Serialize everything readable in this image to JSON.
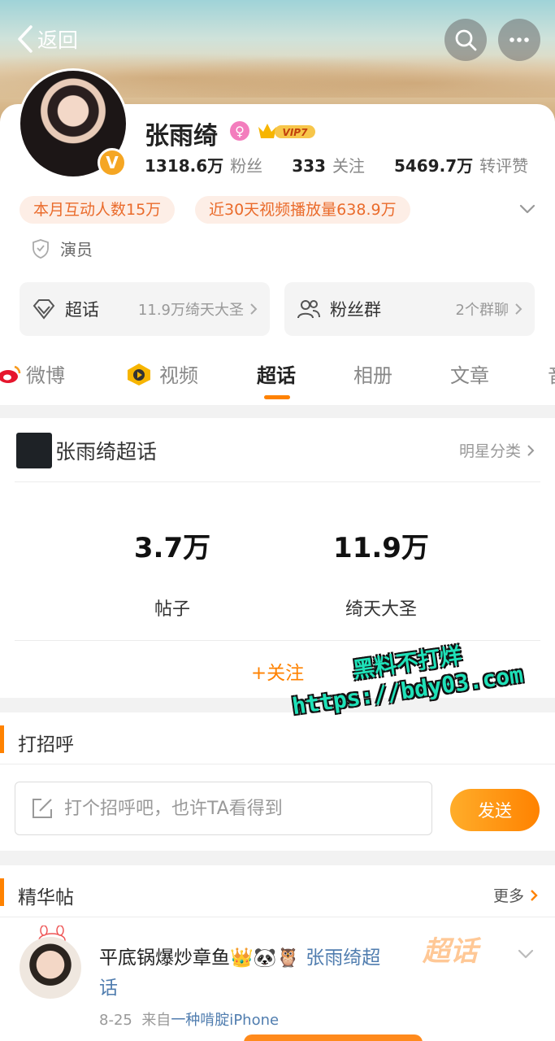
{
  "header": {
    "back_label": "返回"
  },
  "profile": {
    "name": "张雨绮",
    "vip_label": "VIP7",
    "verified_mark": "V",
    "stats": [
      {
        "value": "1318.6万",
        "label": "粉丝"
      },
      {
        "value": "333",
        "label": "关注"
      },
      {
        "value": "5469.7万",
        "label": "转评赞"
      }
    ],
    "chips": [
      "本月互动人数15万",
      "近30天视频播放量638.9万"
    ],
    "role": "演员"
  },
  "quick_links": {
    "chaohua": {
      "title": "超话",
      "sub": "11.9万绮天大圣"
    },
    "fans_group": {
      "title": "粉丝群",
      "sub": "2个群聊"
    }
  },
  "tabs": [
    "微博",
    "视频",
    "超话",
    "相册",
    "文章",
    "音"
  ],
  "active_tab": "超话",
  "supertopic": {
    "title": "张雨绮超话",
    "category": "明星分类",
    "posts_count": "3.7万",
    "posts_label": "帖子",
    "fans_count": "11.9万",
    "fans_label": "绮天大圣",
    "follow_label": "+关注"
  },
  "greeting": {
    "title": "打招呼",
    "placeholder": "打个招呼吧，也许TA看得到",
    "send_label": "发送"
  },
  "featured": {
    "title": "精华帖",
    "more_label": "更多",
    "watermark_label": "超话",
    "post": {
      "text": "平底锅爆炒章鱼",
      "emoji": "👑🐼🦉",
      "link_text": "张雨绮超话",
      "date": "8-25",
      "source_prefix": "来自",
      "source": "一种啃腚iPhone"
    }
  },
  "watermark": {
    "line1": "黑料不打烊",
    "line2": "https://bdy03.com"
  },
  "colors": {
    "accent": "#ff8200",
    "link": "#507daf",
    "chip_text": "#ea6b2b",
    "chip_bg": "#fdeee6"
  }
}
